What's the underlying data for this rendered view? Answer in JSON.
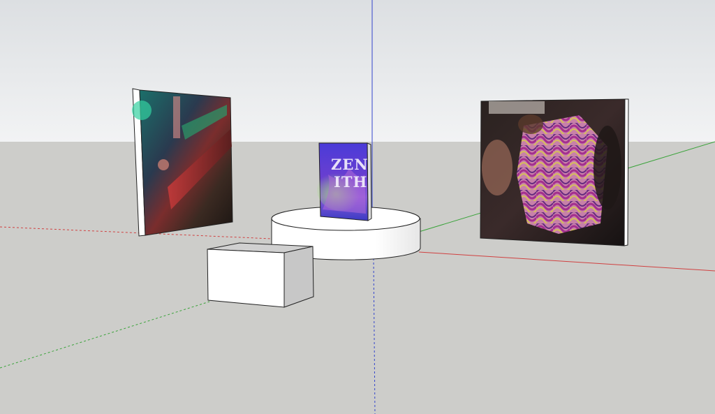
{
  "colors": {
    "sky_top": "#dcdfe2",
    "sky_bottom": "#f2f3f4",
    "ground": "#cdcdca",
    "axis_red": "#d04040",
    "axis_green": "#3aa33a",
    "axis_blue": "#3344cc",
    "model_white": "#ffffff",
    "model_shade": "#c7c7c7",
    "edge": "#222222"
  },
  "scene": {
    "book_cover": {
      "title_line1": "ZEN",
      "title_line2": "ITH"
    }
  }
}
